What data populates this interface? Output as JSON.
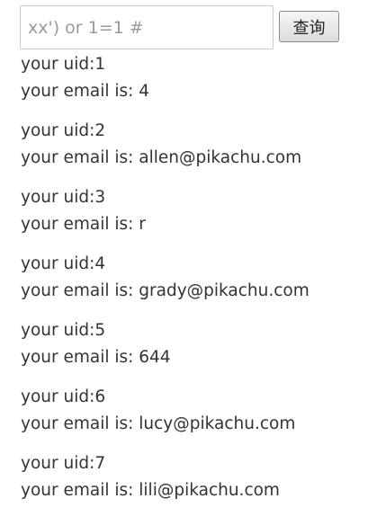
{
  "search": {
    "placeholder": "xx') or 1=1 #",
    "value": "",
    "button_label": "查询"
  },
  "results": [
    {
      "uid_line": "your uid:1",
      "email_line": "your email is: 4"
    },
    {
      "uid_line": "your uid:2",
      "email_line": "your email is: allen@pikachu.com"
    },
    {
      "uid_line": "your uid:3",
      "email_line": "your email is: r"
    },
    {
      "uid_line": "your uid:4",
      "email_line": "your email is: grady@pikachu.com"
    },
    {
      "uid_line": "your uid:5",
      "email_line": "your email is: 644"
    },
    {
      "uid_line": "your uid:6",
      "email_line": "your email is: lucy@pikachu.com"
    },
    {
      "uid_line": "your uid:7",
      "email_line": "your email is: lili@pikachu.com"
    }
  ]
}
